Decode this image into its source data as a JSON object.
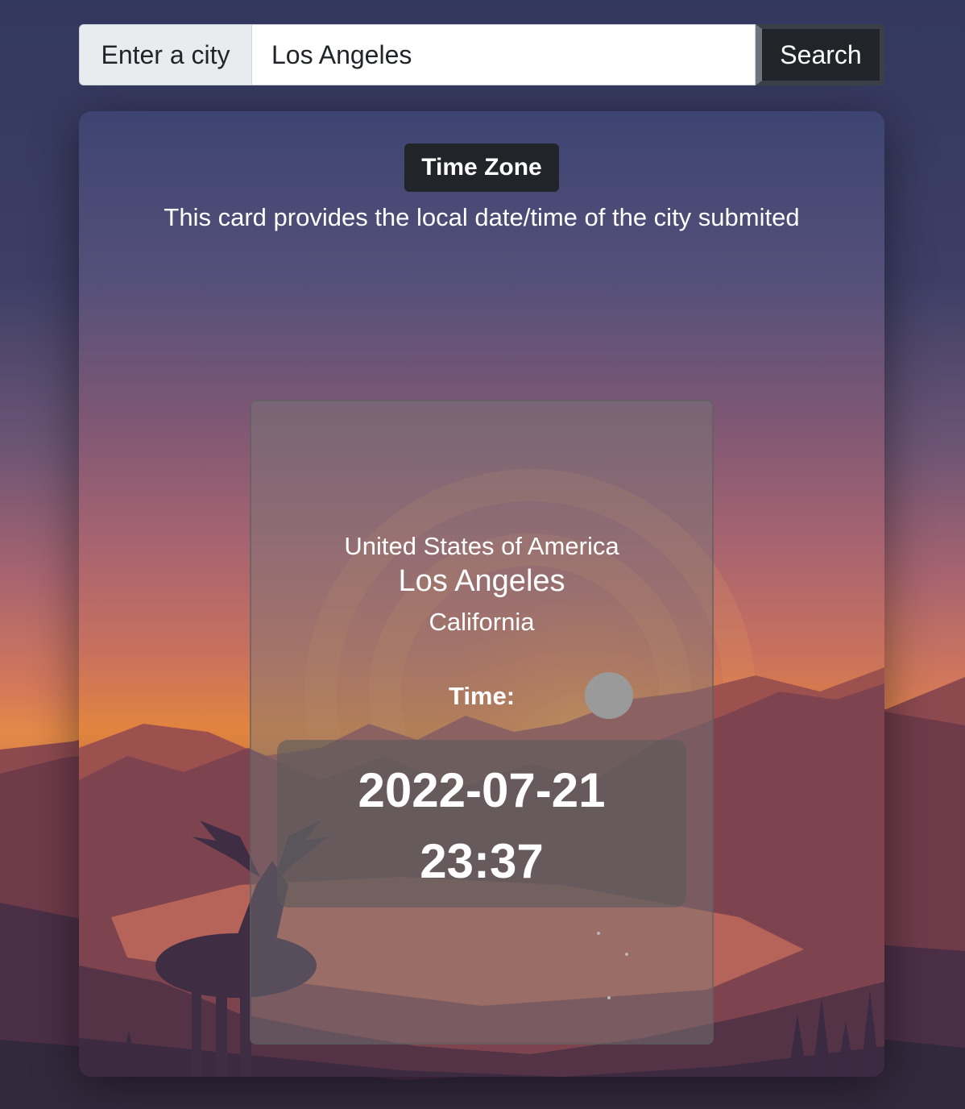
{
  "search": {
    "prefix_label": "Enter a city",
    "value": "Los Angeles",
    "button_label": "Search"
  },
  "card": {
    "badge": "Time Zone",
    "description": "This card provides the local date/time of the city submited"
  },
  "location": {
    "country": "United States of America",
    "city": "Los Angeles",
    "region": "California"
  },
  "time": {
    "label": "Time:",
    "date": "2022-07-21",
    "clock": "23:37"
  },
  "icons": {
    "moon": "moon-icon",
    "stars": "stars-icon"
  },
  "colors": {
    "badge_bg": "#212529",
    "button_bg": "#212529",
    "prefix_bg": "#e9ecef",
    "sky_top": "#34395f",
    "sunset_orange": "#e0834a"
  }
}
